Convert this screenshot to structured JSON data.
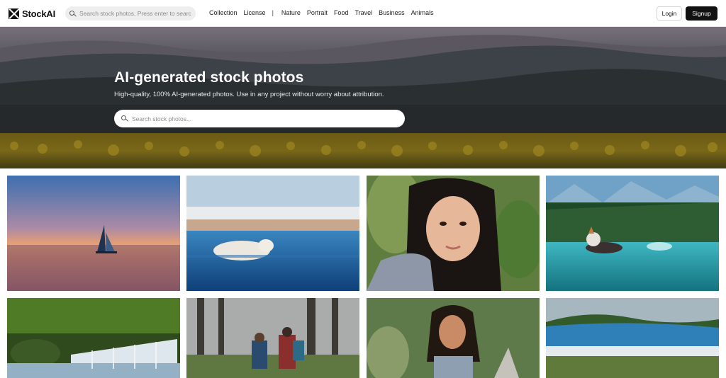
{
  "brand": {
    "name": "StockAI"
  },
  "top_search": {
    "placeholder": "Search stock photos. Press enter to search."
  },
  "nav": {
    "items": [
      "Collection",
      "License",
      "Nature",
      "Portrait",
      "Food",
      "Travel",
      "Business",
      "Animals"
    ],
    "separator": "|"
  },
  "auth": {
    "login_label": "Login",
    "signup_label": "Signup"
  },
  "hero": {
    "title": "AI-generated stock photos",
    "subtitle": "High-quality, 100% AI-generated photos. Use in any project without worry about attribution.",
    "search_placeholder": "Search stock photos..."
  },
  "icons": {
    "logo": "stockai-x-logo",
    "search": "search-icon"
  },
  "colors": {
    "signup_bg": "#111111",
    "top_search_bg": "#eeeeee"
  }
}
